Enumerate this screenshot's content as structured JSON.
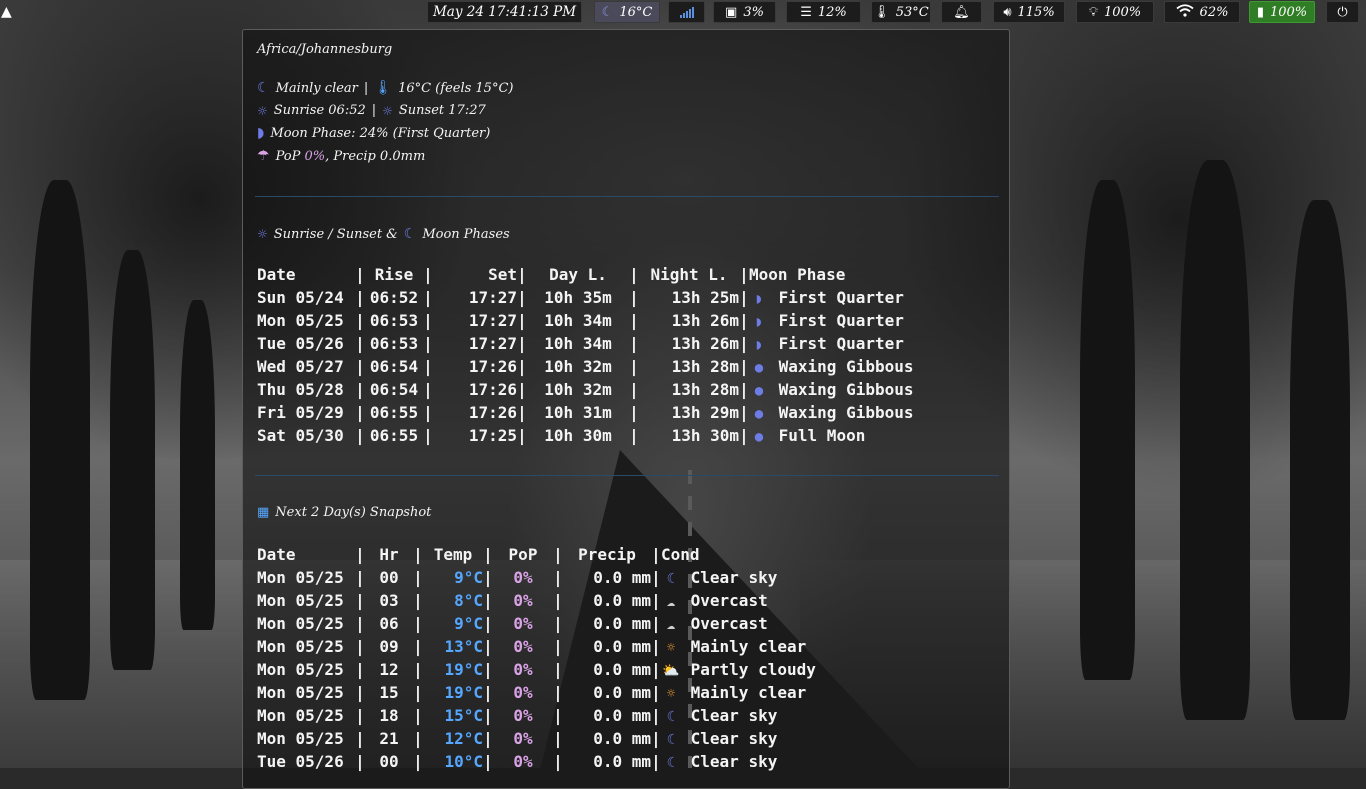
{
  "topbar": {
    "clock": "May 24 17:41:13 PM",
    "weather": "16°C",
    "cpu": "3%",
    "memory": "12%",
    "temperature": "53°C",
    "volume": "115%",
    "brightness": "100%",
    "wifi": "62%",
    "battery": "100%"
  },
  "panel": {
    "timezone": "Africa/Johannesburg",
    "current": {
      "condition": "Mainly clear",
      "sep1": "|",
      "temp": "16°C (feels 15°C)",
      "sunrise": "Sunrise 06:52",
      "sep2": "|",
      "sunset": "Sunset 17:27",
      "moon_phase": "Moon Phase: 24% (First Quarter)",
      "pop_label": "PoP",
      "pop_value": "0%",
      "precip": ", Precip 0.0mm"
    },
    "sun_moon_title_a": "Sunrise / Sunset &",
    "sun_moon_title_b": "Moon Phases",
    "sun_table": {
      "headers": [
        "Date",
        "Rise",
        "Set",
        "Day L.",
        "Night L.",
        "Moon Phase"
      ],
      "rows": [
        [
          "Sun 05/24",
          "06:52",
          "17:27",
          "10h 35m",
          "13h 25m",
          "First Quarter"
        ],
        [
          "Mon 05/25",
          "06:53",
          "17:27",
          "10h 34m",
          "13h 26m",
          "First Quarter"
        ],
        [
          "Tue 05/26",
          "06:53",
          "17:27",
          "10h 34m",
          "13h 26m",
          "First Quarter"
        ],
        [
          "Wed 05/27",
          "06:54",
          "17:26",
          "10h 32m",
          "13h 28m",
          "Waxing Gibbous"
        ],
        [
          "Thu 05/28",
          "06:54",
          "17:26",
          "10h 32m",
          "13h 28m",
          "Waxing Gibbous"
        ],
        [
          "Fri 05/29",
          "06:55",
          "17:26",
          "10h 31m",
          "13h 29m",
          "Waxing Gibbous"
        ],
        [
          "Sat 05/30",
          "06:55",
          "17:25",
          "10h 30m",
          "13h 30m",
          "Full Moon"
        ]
      ]
    },
    "snapshot_title": "Next 2 Day(s) Snapshot",
    "snap_table": {
      "headers": [
        "Date",
        "Hr",
        "Temp",
        "PoP",
        "Precip",
        "Cond"
      ],
      "rows": [
        [
          "Mon 05/25",
          "00",
          "9°C",
          "0%",
          "0.0 mm",
          "Clear sky"
        ],
        [
          "Mon 05/25",
          "03",
          "8°C",
          "0%",
          "0.0 mm",
          "Overcast"
        ],
        [
          "Mon 05/25",
          "06",
          "9°C",
          "0%",
          "0.0 mm",
          "Overcast"
        ],
        [
          "Mon 05/25",
          "09",
          "13°C",
          "0%",
          "0.0 mm",
          "Mainly clear"
        ],
        [
          "Mon 05/25",
          "12",
          "19°C",
          "0%",
          "0.0 mm",
          "Partly cloudy"
        ],
        [
          "Mon 05/25",
          "15",
          "19°C",
          "0%",
          "0.0 mm",
          "Mainly clear"
        ],
        [
          "Mon 05/25",
          "18",
          "15°C",
          "0%",
          "0.0 mm",
          "Clear sky"
        ],
        [
          "Mon 05/25",
          "21",
          "12°C",
          "0%",
          "0.0 mm",
          "Clear sky"
        ],
        [
          "Tue 05/26",
          "00",
          "10°C",
          "0%",
          "0.0 mm",
          "Clear sky"
        ]
      ],
      "cond_icons": [
        "moon-icon",
        "cloud-icon",
        "cloud-icon",
        "sun-icon",
        "sun-cloud-icon",
        "sun-icon",
        "moon-icon",
        "moon-icon",
        "moon-icon"
      ]
    }
  }
}
